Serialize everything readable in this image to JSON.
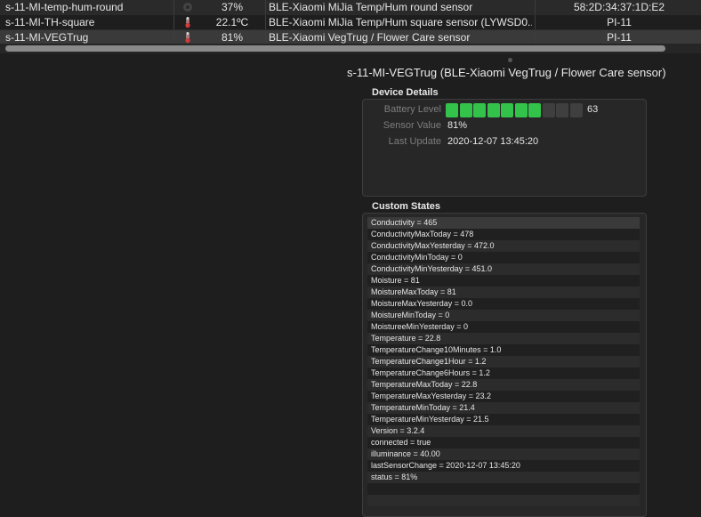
{
  "device_table": {
    "rows": [
      {
        "name": "s-11-MI-temp-hum-round",
        "icon": "sensor-inactive-icon",
        "value": "37%",
        "model": "BLE-Xiaomi MiJia Temp/Hum round  sensor",
        "address": "58:2D:34:37:1D:E2"
      },
      {
        "name": "s-11-MI-TH-square",
        "icon": "thermometer-icon",
        "value": "22.1ºC",
        "model": "BLE-Xiaomi MiJia Temp/Hum square  sensor (LYWSD0...",
        "address": "PI-11"
      },
      {
        "name": "s-11-MI-VEGTrug",
        "icon": "thermometer-icon",
        "value": "81%",
        "model": "BLE-Xiaomi VegTrug / Flower Care sensor",
        "address": "PI-11"
      }
    ]
  },
  "selected_device": {
    "title": "s-11-MI-VEGTrug (BLE-Xiaomi VegTrug / Flower Care sensor)"
  },
  "device_details": {
    "section_title": "Device Details",
    "battery_label": "Battery Level",
    "battery_value": "63",
    "battery_segments_total": 10,
    "battery_segments_filled": 7,
    "sensor_label": "Sensor Value",
    "sensor_value": "81%",
    "update_label": "Last Update",
    "update_value": "2020-12-07 13:45:20"
  },
  "custom_states": {
    "section_title": "Custom States",
    "items": [
      "Conductivity = 465",
      "ConductivityMaxToday = 478",
      "ConductivityMaxYesterday = 472.0",
      "ConductivityMinToday = 0",
      "ConductivityMinYesterday = 451.0",
      "Moisture = 81",
      "MoistureMaxToday = 81",
      "MoistureMaxYesterday = 0.0",
      "MoistureMinToday = 0",
      "MoistureeMinYesterday = 0",
      "Temperature = 22.8",
      "TemperatureChange10Minutes = 1.0",
      "TemperatureChange1Hour = 1.2",
      "TemperatureChange6Hours = 1.2",
      "TemperatureMaxToday = 22.8",
      "TemperatureMaxYesterday = 23.2",
      "TemperatureMinToday = 21.4",
      "TemperatureMinYesterday = 21.5",
      "Version = 3.2.4",
      "connected = true",
      "illuminance = 40.00",
      "lastSensorChange = 2020-12-07 13:45:20",
      "status = 81%"
    ]
  },
  "colors": {
    "battery_on": "#33c24a",
    "battery_off": "#3f3f3f",
    "thermometer_red": "#d33a3a"
  }
}
